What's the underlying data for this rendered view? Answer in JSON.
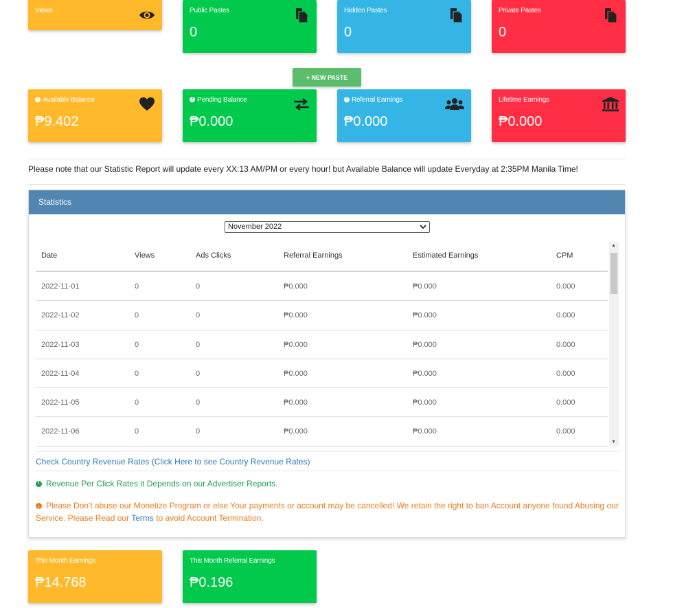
{
  "colors": {
    "orange": "#ffb92b",
    "green": "#00c94b",
    "blue": "#35b5e6",
    "red": "#ff2e44",
    "panel_header": "#5186b3"
  },
  "top_cards": [
    {
      "title": "Views",
      "value": "",
      "icon": "eye-icon"
    },
    {
      "title": "Public Pastes",
      "value": "0",
      "icon": "document-icon"
    },
    {
      "title": "Hidden Pastes",
      "value": "0",
      "icon": "document-icon"
    },
    {
      "title": "Private Pastes",
      "value": "0",
      "icon": "document-icon"
    }
  ],
  "new_paste_label": "+ NEW PASTE",
  "balance_cards": [
    {
      "title": "Available Balance",
      "value": "₱9.402",
      "icon": "heart-icon"
    },
    {
      "title": "Pending Balance",
      "value": "₱0.000",
      "icon": "exchange-icon"
    },
    {
      "title": "Referral Earnings",
      "value": "₱0.000",
      "icon": "users-icon"
    },
    {
      "title": "Lifetime Earnings",
      "value": "₱0.000",
      "icon": "bank-icon"
    }
  ],
  "notice": "Please note that our Statistic Report will update every XX:13 AM/PM or every hour! but Available Balance will update Everyday at 2:35PM Manila Time!",
  "statistics": {
    "heading": "Statistics",
    "selected_month": "November 2022",
    "columns": [
      "Date",
      "Views",
      "Ads Clicks",
      "Referral Earnings",
      "Estimated Earnings",
      "CPM"
    ],
    "rows": [
      [
        "2022-11-01",
        "0",
        "0",
        "₱0.000",
        "₱0.000",
        "0.000"
      ],
      [
        "2022-11-02",
        "0",
        "0",
        "₱0.000",
        "₱0.000",
        "0.000"
      ],
      [
        "2022-11-03",
        "0",
        "0",
        "₱0.000",
        "₱0.000",
        "0.000"
      ],
      [
        "2022-11-04",
        "0",
        "0",
        "₱0.000",
        "₱0.000",
        "0.000"
      ],
      [
        "2022-11-05",
        "0",
        "0",
        "₱0.000",
        "₱0.000",
        "0.000"
      ],
      [
        "2022-11-06",
        "0",
        "0",
        "₱0.000",
        "₱0.000",
        "0.000"
      ]
    ],
    "country_link": "Check Country Revenue Rates (Click Here to see Country Revenue Rates)",
    "info_note": "Revenue Per Click Rates it Depends on our Advertiser Reports.",
    "warning_before": "Please Don't abuse our Monetize Program or else Your payments or account may be cancelled! We retain the right to ban Account anyone found Abusing our Service. Please Read our ",
    "warning_link": "Terms",
    "warning_after": " to avoid Account Termination."
  },
  "month_cards": [
    {
      "title": "This Month Earnings",
      "value": "₱14.768"
    },
    {
      "title": "This Month Referral Earnings",
      "value": "₱0.196"
    }
  ]
}
